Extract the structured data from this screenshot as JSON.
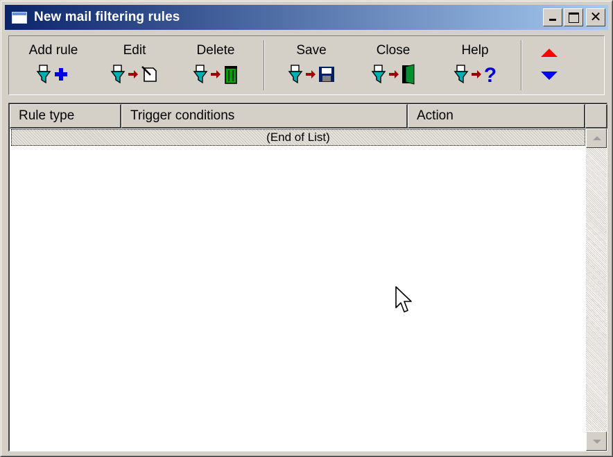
{
  "window": {
    "title": "New mail filtering rules",
    "title_icon": "window-icon",
    "caption_buttons": [
      "minimize",
      "maximize",
      "close"
    ],
    "close_glyph": "✕"
  },
  "toolbar": {
    "add_rule": {
      "label": "Add rule",
      "icon": "filter-plus-icon"
    },
    "edit": {
      "label": "Edit",
      "icon": "filter-edit-icon"
    },
    "delete": {
      "label": "Delete",
      "icon": "filter-trash-icon"
    },
    "save": {
      "label": "Save",
      "icon": "filter-floppy-icon"
    },
    "close": {
      "label": "Close",
      "icon": "filter-door-icon"
    },
    "help": {
      "label": "Help",
      "icon": "filter-question-icon"
    },
    "move_up": {
      "icon": "triangle-up-icon",
      "color": "#ff0000"
    },
    "move_down": {
      "icon": "triangle-down-icon",
      "color": "#0000ff"
    }
  },
  "list": {
    "columns": [
      "Rule type",
      "Trigger conditions",
      "Action"
    ],
    "rows": [],
    "end_marker": "(End of List)"
  },
  "colors": {
    "titlebar_start": "#0a246a",
    "titlebar_end": "#a6caf0",
    "face": "#d4d0c8",
    "filter_icon": "#00a0a0",
    "arrow": "#a00000"
  }
}
